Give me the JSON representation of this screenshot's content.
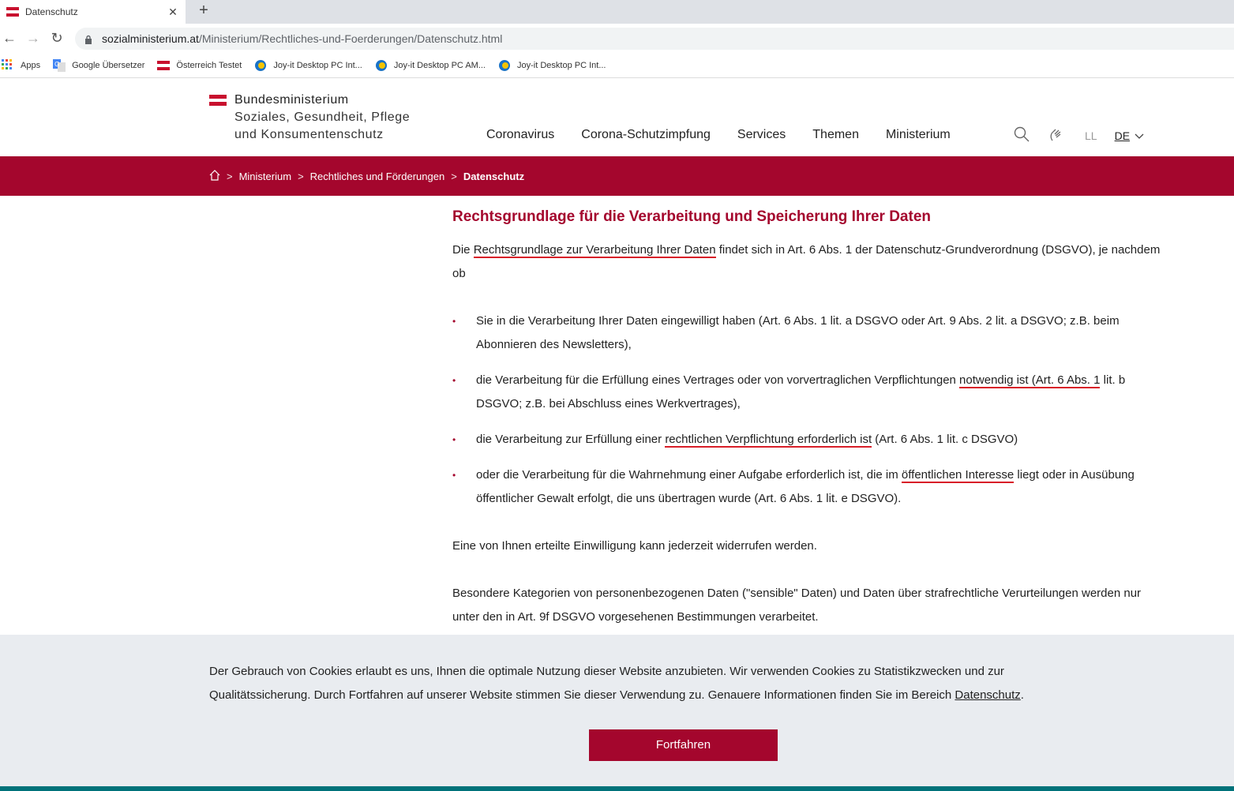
{
  "browser": {
    "tab_title": "Datenschutz",
    "tab_close": "✕",
    "new_tab": "+",
    "url_host": "sozialministerium.at",
    "url_path": "/Ministerium/Rechtliches-und-Foerderungen/Datenschutz.html",
    "bookmarks": [
      {
        "label": "Apps",
        "icon": "apps-grid-icon"
      },
      {
        "label": "Google Übersetzer",
        "icon": "translate-icon"
      },
      {
        "label": "Österreich Testet",
        "icon": "austria-flag-icon"
      },
      {
        "label": "Joy-it Desktop PC Int...",
        "icon": "joyit-icon"
      },
      {
        "label": "Joy-it Desktop PC AM...",
        "icon": "joyit-icon"
      },
      {
        "label": "Joy-it Desktop PC Int...",
        "icon": "joyit-icon"
      }
    ]
  },
  "header": {
    "logo_line1": "Bundesministerium",
    "logo_line2": "Soziales, Gesundheit, Pflege",
    "logo_line3": "und Konsumentenschutz",
    "nav": [
      "Coronavirus",
      "Corona-Schutzimpfung",
      "Services",
      "Themen",
      "Ministerium"
    ],
    "easy_language": "LL",
    "language": "DE"
  },
  "breadcrumb": {
    "items": [
      "Ministerium",
      "Rechtliches und Förderungen"
    ],
    "current": "Datenschutz",
    "separator": ">"
  },
  "content": {
    "heading": "Rechtsgrundlage für die Verarbeitung und Speicherung Ihrer Daten",
    "intro_pre": "Die ",
    "intro_mark": "Rechtsgrundlage zur Verarbeitung Ihrer Daten",
    "intro_post": " findet sich in Art. 6 Abs. 1 der Datenschutz-Grundverordnung (DSGVO), je nachdem ob",
    "bullet1": "Sie in die Verarbeitung Ihrer Daten eingewilligt haben (Art. 6 Abs. 1 lit. a DSGVO oder Art. 9 Abs. 2 lit. a DSGVO; z.B. beim Abonnieren des Newsletters),",
    "bullet2_pre": "die Verarbeitung für die Erfüllung eines Vertrages oder von vorvertraglichen Verpflichtungen ",
    "bullet2_mark": "notwendig ist (Art. 6 Abs. 1",
    "bullet2_post": " lit. b DSGVO; z.B. bei Abschluss eines Werkvertrages),",
    "bullet3_pre": "die Verarbeitung zur Erfüllung einer ",
    "bullet3_mark": "rechtlichen Verpflichtung erforderlich ist",
    "bullet3_post": " (Art. 6 Abs. 1 lit. c DSGVO)",
    "bullet4_pre": "oder die Verarbeitung für die Wahrnehmung einer Aufgabe erforderlich ist, die im ",
    "bullet4_mark": "öffentlichen Interesse",
    "bullet4_post": " liegt oder in Ausübung öffentlicher Gewalt erfolgt, die uns übertragen wurde (Art. 6 Abs. 1 lit. e DSGVO).",
    "para2": "Eine von Ihnen erteilte Einwilligung kann jederzeit widerrufen werden.",
    "para3": "Besondere Kategorien von personenbezogenen Daten (\"sensible\" Daten) und Daten über strafrechtliche Verurteilungen werden nur unter den in Art. 9f DSGVO vorgesehenen Bestimmungen verarbeitet."
  },
  "cookie": {
    "text": "Der Gebrauch von Cookies erlaubt es uns, Ihnen die optimale Nutzung dieser Website anzubieten. Wir verwenden Cookies zu Statistikzwecken und zur Qualitätssicherung. Durch Fortfahren auf unserer Website stimmen Sie dieser Verwendung zu. Genauere Informationen finden Sie im Bereich ",
    "link": "Datenschutz",
    "tail": ".",
    "button": "Fortfahren"
  },
  "colors": {
    "brand_red": "#a4062d",
    "footer_teal": "#00727a",
    "annotation_red": "#d81e28"
  }
}
